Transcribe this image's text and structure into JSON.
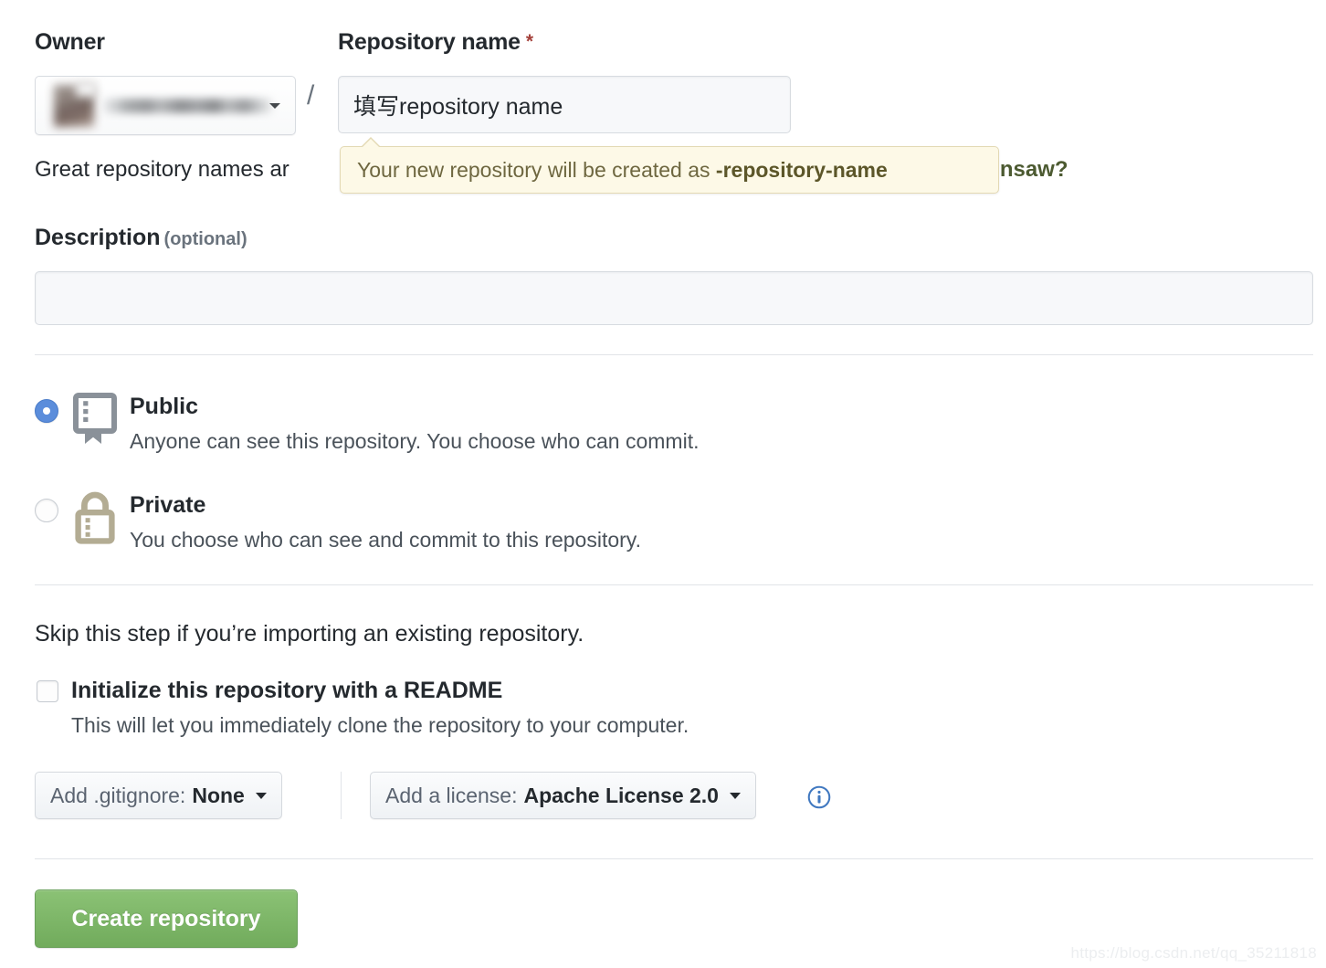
{
  "form": {
    "owner": {
      "label": "Owner",
      "avatar_icon": "user-avatar-blurred",
      "username_redacted": "",
      "caret_icon": "chevron-down-icon"
    },
    "separator": "/",
    "repository_name": {
      "label": "Repository name",
      "required_marker": "*",
      "value": "填写repository name",
      "placeholder": ""
    },
    "name_hint": {
      "prefix": "Great repository names ar",
      "suffix_suggestion": "rry-chainsaw?"
    },
    "tooltip": {
      "text_prefix": "Your new repository will be created as ",
      "text_strong": "-repository-name"
    },
    "description": {
      "label": "Description",
      "optional_note": "(optional)",
      "value": "",
      "placeholder": ""
    },
    "visibility": {
      "options": [
        {
          "id": "public",
          "title": "Public",
          "description": "Anyone can see this repository. You choose who can commit.",
          "icon": "repo-book-icon",
          "selected": true
        },
        {
          "id": "private",
          "title": "Private",
          "description": "You choose who can see and commit to this repository.",
          "icon": "lock-icon",
          "selected": false
        }
      ]
    },
    "initialize": {
      "skip_text": "Skip this step if you’re importing an existing repository.",
      "checkbox_label": "Initialize this repository with a README",
      "checkbox_description": "This will let you immediately clone the repository to your computer.",
      "checked": false
    },
    "gitignore": {
      "prefix": "Add .gitignore:",
      "value": "None",
      "caret_icon": "chevron-down-icon"
    },
    "license": {
      "prefix": "Add a license:",
      "value": "Apache License 2.0",
      "caret_icon": "chevron-down-icon",
      "info_icon": "info-circle-icon"
    },
    "submit": {
      "label": "Create repository"
    }
  },
  "watermark": {
    "text": "https://blog.csdn.net/qq_35211818"
  },
  "colors": {
    "accent_blue": "#5b8ddb",
    "submit_green": "#71ab5c",
    "tooltip_bg": "#fdf9e7",
    "tooltip_border": "#e3d9b4",
    "tooltip_text": "#6e6740",
    "suggestion_green": "#4c5a31",
    "lock_tan": "#b3ac93",
    "repo_gray": "#8a9199",
    "info_blue": "#4078c0",
    "divider": "#e1e4e8"
  }
}
